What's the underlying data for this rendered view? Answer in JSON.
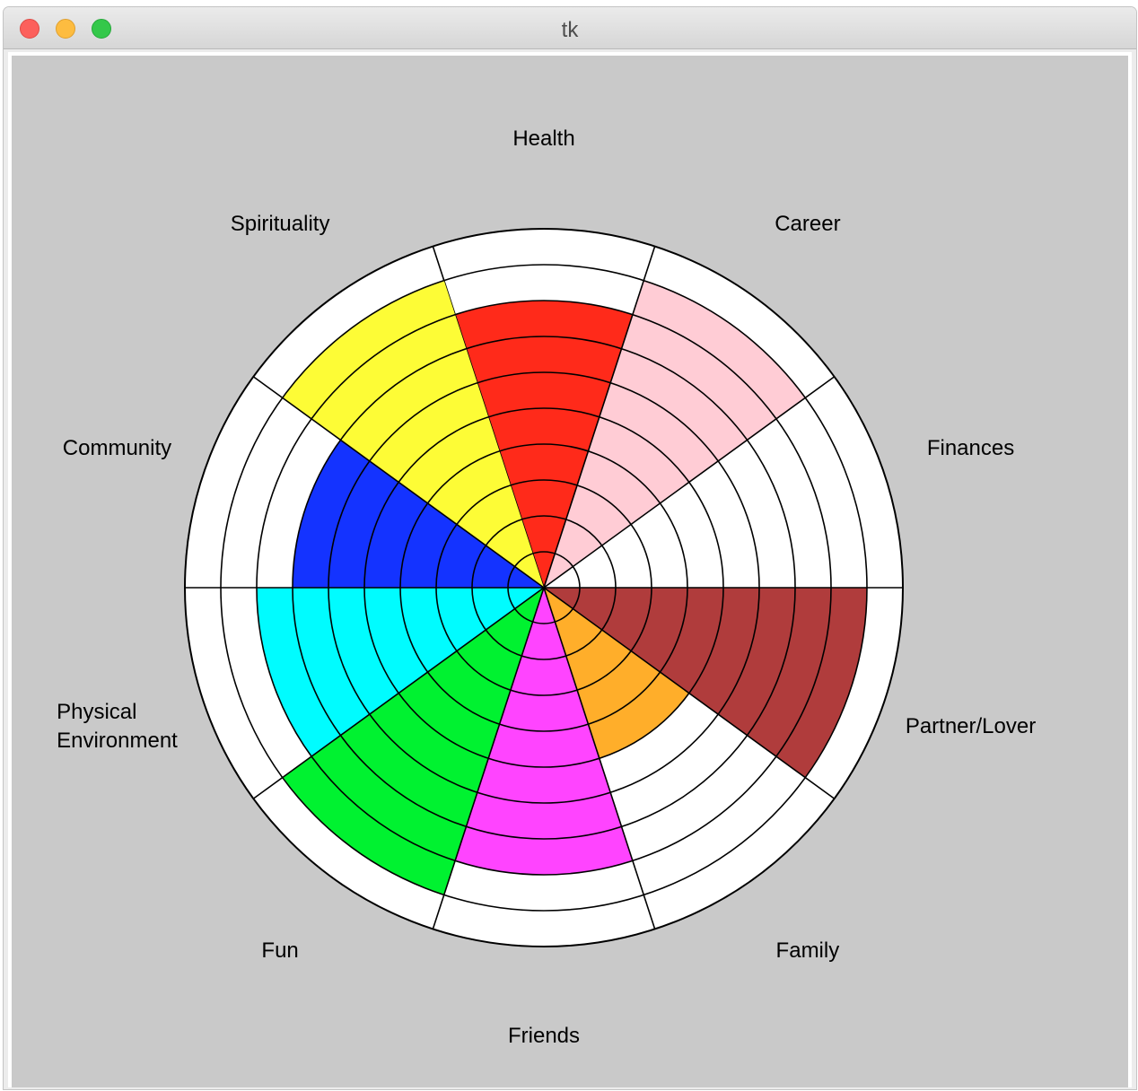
{
  "window": {
    "title": "tk"
  },
  "wheel": {
    "max_score": 10,
    "categories": [
      {
        "name": "Health",
        "score": 8,
        "color": "#ff2a1a"
      },
      {
        "name": "Career",
        "score": 9,
        "color": "#ffccd5"
      },
      {
        "name": "Finances",
        "score": 0,
        "color": "#c9c9c9"
      },
      {
        "name": "Partner/Lover",
        "score": 9,
        "color": "#b03c3c"
      },
      {
        "name": "Family",
        "score": 5,
        "color": "#ffae2a"
      },
      {
        "name": "Friends",
        "score": 8,
        "color": "#ff44ff"
      },
      {
        "name": "Fun",
        "score": 9,
        "color": "#00f230"
      },
      {
        "name": "Physical\nEnvironment",
        "score": 8,
        "color": "#00fcff"
      },
      {
        "name": "Community",
        "score": 7,
        "color": "#1433ff"
      },
      {
        "name": "Spirituality",
        "score": 9,
        "color": "#fdfc36"
      }
    ]
  }
}
